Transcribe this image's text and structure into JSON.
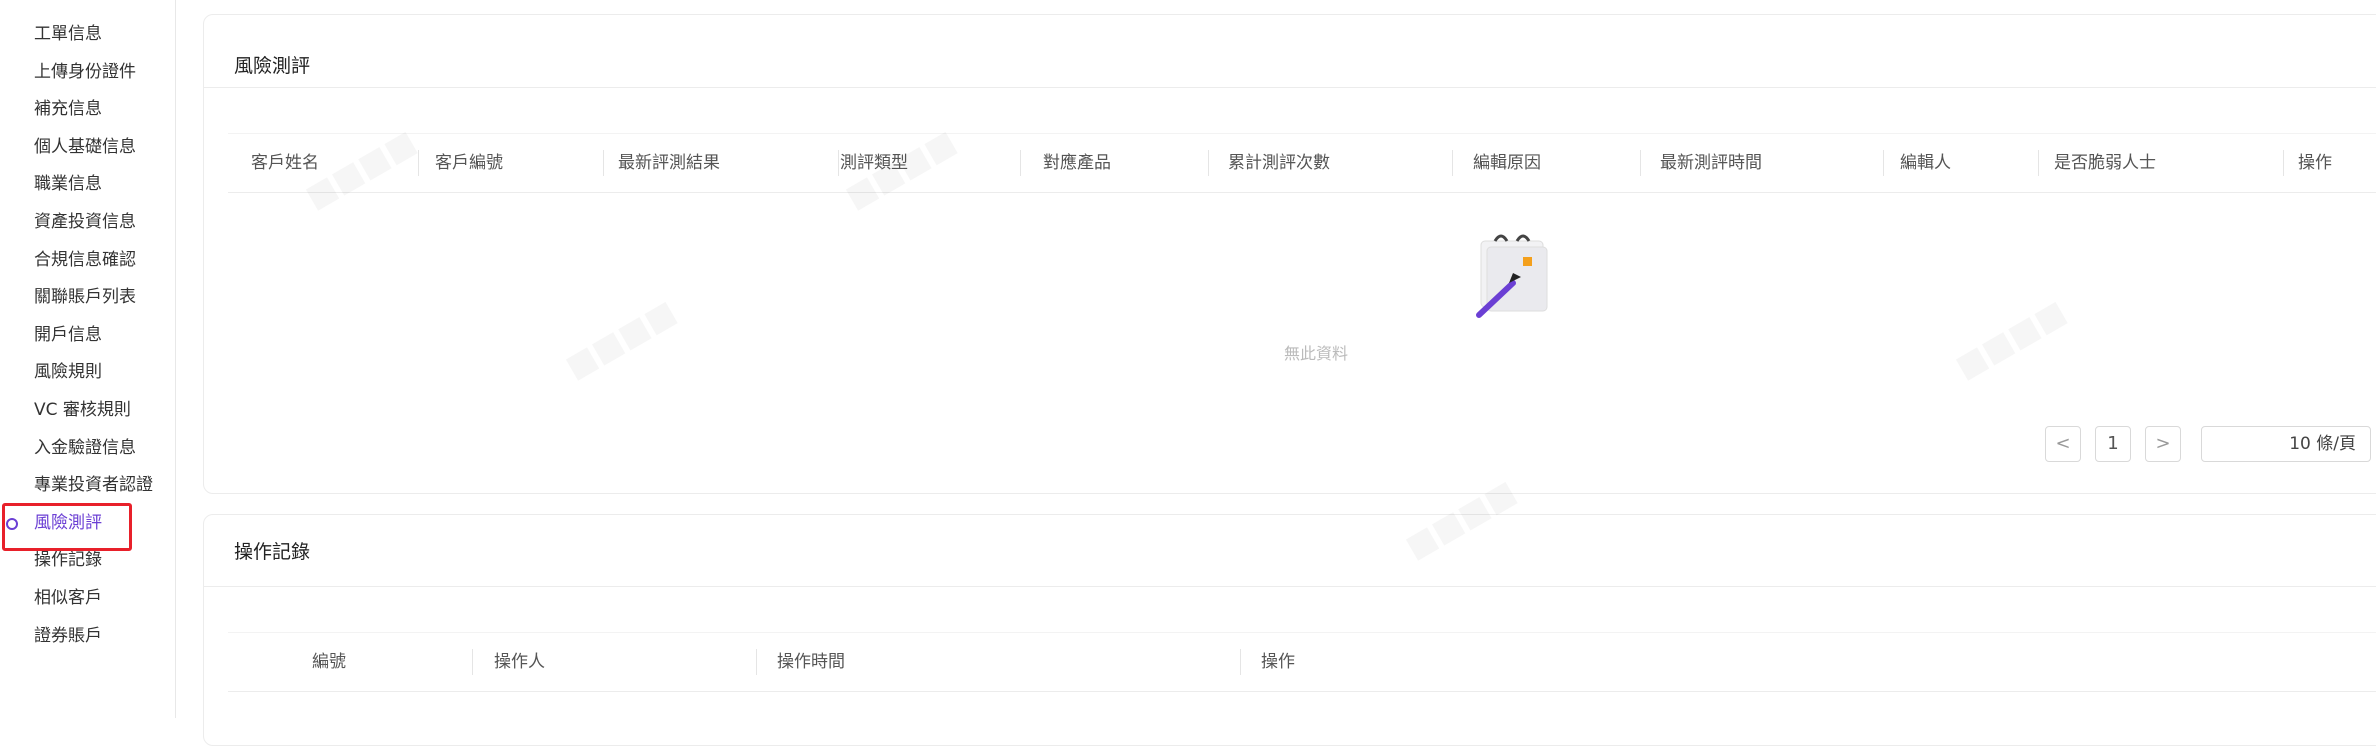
{
  "sidebar": {
    "items": [
      {
        "label": "工單信息"
      },
      {
        "label": "上傳身份證件"
      },
      {
        "label": "補充信息"
      },
      {
        "label": "個人基礎信息"
      },
      {
        "label": "職業信息"
      },
      {
        "label": "資產投資信息"
      },
      {
        "label": "合規信息確認"
      },
      {
        "label": "關聯賬戶列表"
      },
      {
        "label": "開戶信息"
      },
      {
        "label": "風險規則"
      },
      {
        "label": "VC 審核規則"
      },
      {
        "label": "入金驗證信息"
      },
      {
        "label": "專業投資者認證"
      },
      {
        "label": "風險測評",
        "active": true
      },
      {
        "label": "操作記錄"
      },
      {
        "label": "相似客戶"
      },
      {
        "label": "證券賬戶"
      }
    ]
  },
  "risk_panel": {
    "title": "風險測評",
    "columns": [
      "客戶姓名",
      "客戶編號",
      "最新評測結果",
      "測評類型",
      "對應產品",
      "累計測評次數",
      "編輯原因",
      "最新測評時間",
      "編輯人",
      "是否脆弱人士",
      "操作"
    ],
    "empty_text": "無此資料",
    "pagination": {
      "prev": "<",
      "page": "1",
      "next": ">",
      "page_size": "10 條/頁"
    }
  },
  "log_panel": {
    "title": "操作記錄",
    "columns": [
      "編號",
      "操作人",
      "操作時間",
      "操作"
    ]
  },
  "colors": {
    "accent": "#6b3fd4",
    "highlight": "#e8202a"
  },
  "icons": {
    "empty": "empty-notebook-pen-icon"
  }
}
